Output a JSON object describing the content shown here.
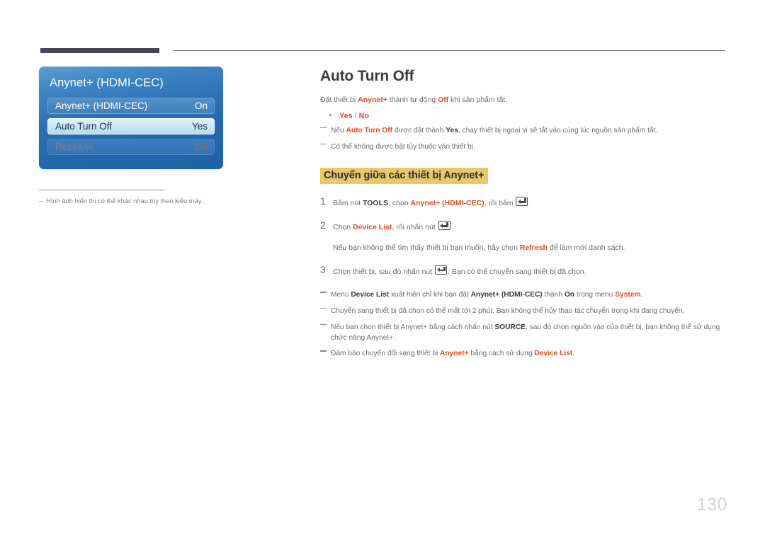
{
  "page": {
    "number": "130"
  },
  "tv_menu": {
    "title": "Anynet+ (HDMI-CEC)",
    "rows": [
      {
        "label": "Anynet+ (HDMI-CEC)",
        "value": "On",
        "state": "normal"
      },
      {
        "label": "Auto Turn Off",
        "value": "Yes",
        "state": "selected"
      },
      {
        "label": "Receiver",
        "value": "Off",
        "state": "disabled"
      }
    ]
  },
  "caption": {
    "dash": "–",
    "text": "Hình ảnh hiển thị có thể khác nhau tùy theo kiểu máy."
  },
  "content": {
    "title": "Auto Turn Off",
    "intro": {
      "part1": "Đặt thiết bị ",
      "hl1": "Anynet+",
      "part2": " thành tự động ",
      "hl2": "Off",
      "part3": " khi sản phẩm tắt."
    },
    "bullet": {
      "yes": "Yes",
      "separator": " / ",
      "no": "No"
    },
    "notes_top": [
      {
        "segments": [
          {
            "t": "Nếu ",
            "s": "plain"
          },
          {
            "t": "Auto Turn Off",
            "s": "hl"
          },
          {
            "t": " được đặt thành ",
            "s": "plain"
          },
          {
            "t": "Yes",
            "s": "dk"
          },
          {
            "t": ", chạy thiết bị ngoại vi sẽ tắt vào cùng lúc nguồn sản phẩm tắt.",
            "s": "plain"
          }
        ]
      },
      {
        "segments": [
          {
            "t": "Có thể không được bật tùy thuộc vào thiết bị.",
            "s": "plain"
          }
        ]
      }
    ],
    "subheading": "Chuyển giữa các thiết bị Anynet+",
    "steps": [
      {
        "num": "1",
        "segments": [
          {
            "t": "Bấm nút ",
            "s": "plain"
          },
          {
            "t": "TOOLS",
            "s": "dk"
          },
          {
            "t": ", chọn ",
            "s": "plain"
          },
          {
            "t": "Anynet+ (HDMI-CEC)",
            "s": "hl"
          },
          {
            "t": ", rồi bấm ",
            "s": "plain"
          },
          {
            "t": "",
            "s": "enter-icon"
          },
          {
            "t": ".",
            "s": "plain"
          }
        ]
      },
      {
        "num": "2",
        "segments": [
          {
            "t": "Chọn ",
            "s": "plain"
          },
          {
            "t": "Device List",
            "s": "hl"
          },
          {
            "t": ", rồi nhấn nút ",
            "s": "plain"
          },
          {
            "t": "",
            "s": "enter-icon"
          },
          {
            "t": ".",
            "s": "plain"
          }
        ],
        "sub_segments": [
          {
            "t": "Nếu bạn không thể tìm thấy thiết bị bạn muốn, hãy chọn ",
            "s": "plain"
          },
          {
            "t": "Refresh",
            "s": "hl"
          },
          {
            "t": " để làm mới danh sách.",
            "s": "plain"
          }
        ]
      },
      {
        "num": "3",
        "segments": [
          {
            "t": "Chọn thiết bị, sau đó nhấn nút ",
            "s": "plain"
          },
          {
            "t": "",
            "s": "enter-icon"
          },
          {
            "t": ". Bạn có thể chuyển sang thiết bị đã chọn.",
            "s": "plain"
          }
        ]
      }
    ],
    "notes_bottom": [
      {
        "segments": [
          {
            "t": "Menu ",
            "s": "plain"
          },
          {
            "t": "Device List",
            "s": "dk"
          },
          {
            "t": " xuất hiện chỉ khi bạn đặt ",
            "s": "plain"
          },
          {
            "t": "Anynet+ (HDMI-CEC)",
            "s": "dk"
          },
          {
            "t": " thành ",
            "s": "plain"
          },
          {
            "t": "On",
            "s": "dk"
          },
          {
            "t": " trong menu ",
            "s": "plain"
          },
          {
            "t": "System",
            "s": "hl"
          },
          {
            "t": ".",
            "s": "plain"
          }
        ]
      },
      {
        "segments": [
          {
            "t": "Chuyển sang thiết bị đã chọn có thể mất tới 2 phút. Bạn không thể hủy thao tác chuyển trong khi đang chuyển.",
            "s": "plain"
          }
        ]
      },
      {
        "segments": [
          {
            "t": "Nếu bạn chọn thiết bị Anynet+ bằng cách nhấn nút ",
            "s": "plain"
          },
          {
            "t": "SOURCE",
            "s": "dk"
          },
          {
            "t": ", sau đó chọn nguồn vào của thiết bị, bạn không thể sử dụng chức năng Anynet+.",
            "s": "plain"
          }
        ]
      },
      {
        "segments": [
          {
            "t": "Đảm bảo chuyển đổi sang thiết bị ",
            "s": "plain"
          },
          {
            "t": "Anynet+",
            "s": "hl"
          },
          {
            "t": " bằng cách sử dụng ",
            "s": "plain"
          },
          {
            "t": "Device List",
            "s": "hl"
          },
          {
            "t": ".",
            "s": "plain"
          }
        ]
      }
    ]
  },
  "colors": {
    "accent_orange": "#e8491f",
    "highlight_yellow": "#e9c86a",
    "rule_dark": "#474554",
    "menu_blue": "#2b6fb4",
    "body_gray": "#6c6a73"
  }
}
